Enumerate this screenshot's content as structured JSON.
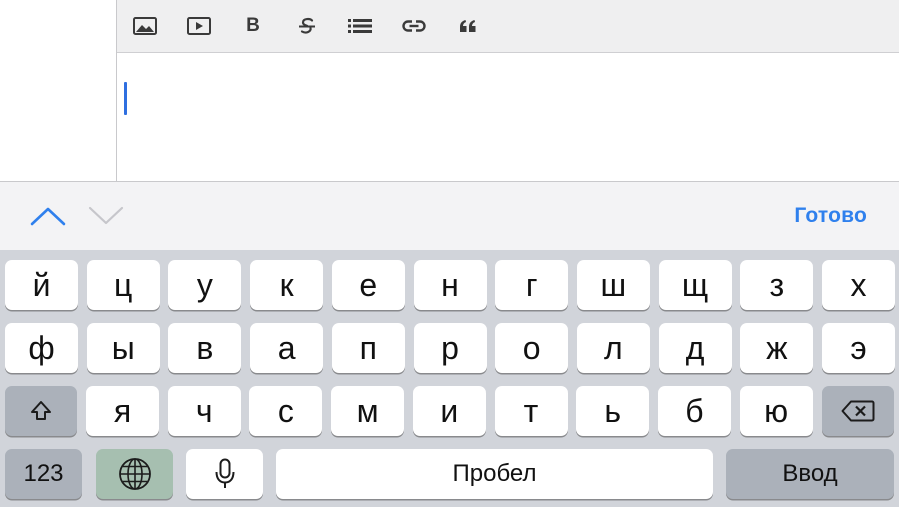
{
  "toolbar": {
    "buttons": [
      "image-icon",
      "video-icon",
      "bold-icon",
      "strikethrough-icon",
      "list-icon",
      "link-icon",
      "quote-icon"
    ],
    "bold_label": "B"
  },
  "accessory": {
    "done_label": "Готово",
    "accent": "#2f80ed"
  },
  "keyboard": {
    "row1": [
      "й",
      "ц",
      "у",
      "к",
      "е",
      "н",
      "г",
      "ш",
      "щ",
      "з",
      "х"
    ],
    "row2": [
      "ф",
      "ы",
      "в",
      "а",
      "п",
      "р",
      "о",
      "л",
      "д",
      "ж",
      "э"
    ],
    "row3": [
      "я",
      "ч",
      "с",
      "м",
      "и",
      "т",
      "ь",
      "б",
      "ю"
    ],
    "numbers_label": "123",
    "space_label": "Пробел",
    "return_label": "Ввод"
  }
}
